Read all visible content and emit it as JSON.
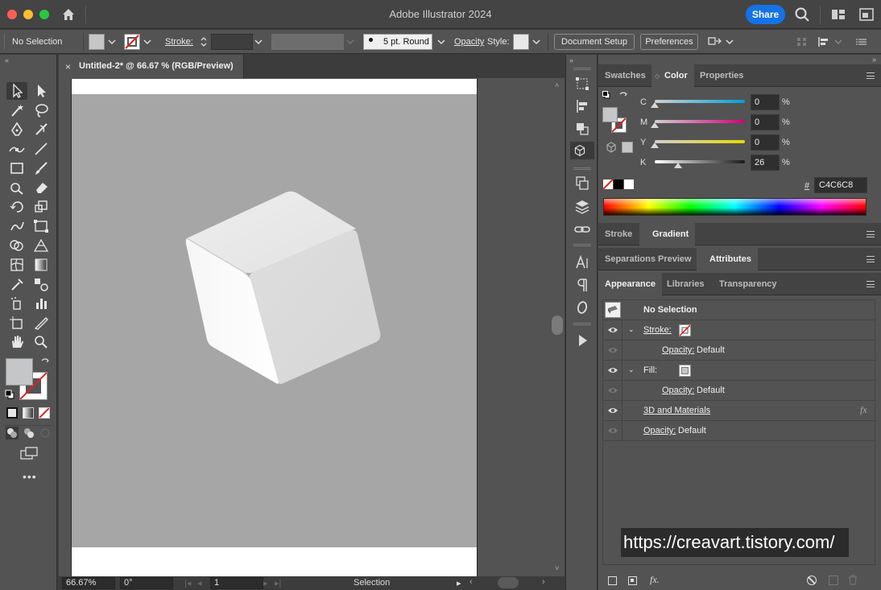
{
  "window": {
    "title": "Adobe Illustrator 2024",
    "share_label": "Share"
  },
  "control_bar": {
    "selection_label": "No Selection",
    "stroke_label": "Stroke:",
    "brush_label": "5 pt. Round",
    "opacity_label": "Opacity",
    "style_label": "Style:",
    "document_setup_label": "Document Setup",
    "preferences_label": "Preferences"
  },
  "document": {
    "tab_label": "Untitled-2* @ 66.67 % (RGB/Preview)",
    "close_glyph": "×"
  },
  "status_bar": {
    "zoom": "66.67%",
    "rotation": "0°",
    "artboard_number": "1",
    "tool_name": "Selection"
  },
  "color_panel": {
    "tabs": [
      "Swatches",
      "Color",
      "Properties"
    ],
    "active_tab": "Color",
    "channels": [
      {
        "name": "C",
        "value": "0",
        "level": 0.0
      },
      {
        "name": "M",
        "value": "0",
        "level": 0.0
      },
      {
        "name": "Y",
        "value": "0",
        "level": 0.0
      },
      {
        "name": "K",
        "value": "26",
        "level": 0.26
      }
    ],
    "percent_sign": "%",
    "hex_hash": "#",
    "hex_value": "C4C6C8",
    "fill_color": "#c4c6c8"
  },
  "gradient_panel": {
    "tabs": [
      "Stroke",
      "Gradient"
    ],
    "active_tab": "Gradient"
  },
  "attributes_panel": {
    "tabs": [
      "Separations Preview",
      "Attributes"
    ],
    "active_tab": "Attributes"
  },
  "appearance_panel": {
    "tabs": [
      "Appearance",
      "Libraries",
      "Transparency"
    ],
    "active_tab": "Appearance",
    "header": "No Selection",
    "rows": {
      "stroke_label": "Stroke:",
      "stroke_opacity_label": "Opacity:",
      "stroke_opacity_value": "Default",
      "fill_label": "Fill:",
      "fill_opacity_label": "Opacity:",
      "fill_opacity_value": "Default",
      "effect_label": "3D and Materials",
      "fx_label": "fx",
      "opacity_label": "Opacity:",
      "opacity_value": "Default"
    },
    "footer_fx": "fx."
  },
  "watermark": "https://creavart.tistory.com/",
  "colors": {
    "accent": "#1473e6",
    "panel_bg": "#535353",
    "artboard_bg": "#a6a6a6",
    "cube_light": "#ececec",
    "cube_mid": "#dcdcdc"
  }
}
